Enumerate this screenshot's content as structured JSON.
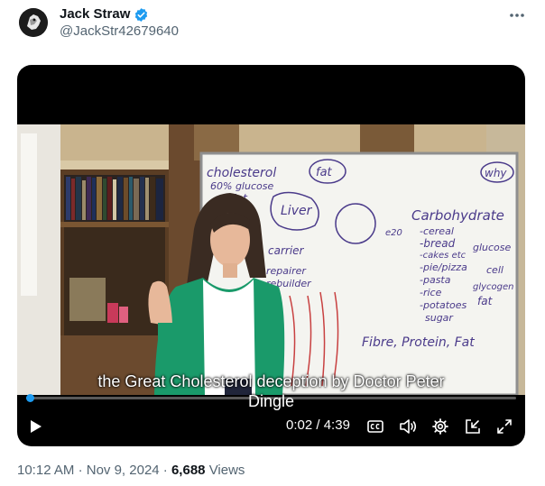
{
  "author": {
    "display_name": "Jack Straw",
    "handle": "@JackStr42679640",
    "verified_color": "#1d9bf0"
  },
  "menu": {
    "icon": "more-horizontal-icon"
  },
  "video": {
    "caption_line1": "the Great Cholesterol deception by Doctor Peter",
    "caption_line2": "Dingle",
    "current_time": "0:02",
    "time_separator": "/",
    "duration": "4:39",
    "progress_fraction": 0.007,
    "accent_color": "#1d9bf0",
    "whiteboard": {
      "word_cholesterol": "cholesterol",
      "word_glucose_pct": "60% glucose",
      "word_fat_left": "Fat",
      "word_fat_circled": "fat",
      "word_liver": "Liver",
      "word_carrier": "carrier",
      "word_repairer": "repairer",
      "word_rebuilder": "rebuilder",
      "word_why": "why",
      "word_carbohydrate": "Carbohydrate",
      "carb_items": [
        "-cereal",
        "-bread",
        "-cakes etc",
        "-pie/pizza",
        "-pasta",
        "-rice",
        "-potatoes",
        "sugar"
      ],
      "word_glucose_right": "glucose",
      "word_cell": "cell",
      "word_glycogen": "glycogen",
      "word_fat_right": "fat",
      "word_fibre": "Fibre, Protein, Fat",
      "word_e20": "e20"
    },
    "icons": [
      "play-icon",
      "captions-icon",
      "volume-icon",
      "settings-icon",
      "popout-icon",
      "fullscreen-icon"
    ]
  },
  "meta": {
    "time": "10:12 AM",
    "sep1": "·",
    "date": "Nov 9, 2024",
    "sep2": "·",
    "views_count": "6,688",
    "views_label": "Views"
  }
}
